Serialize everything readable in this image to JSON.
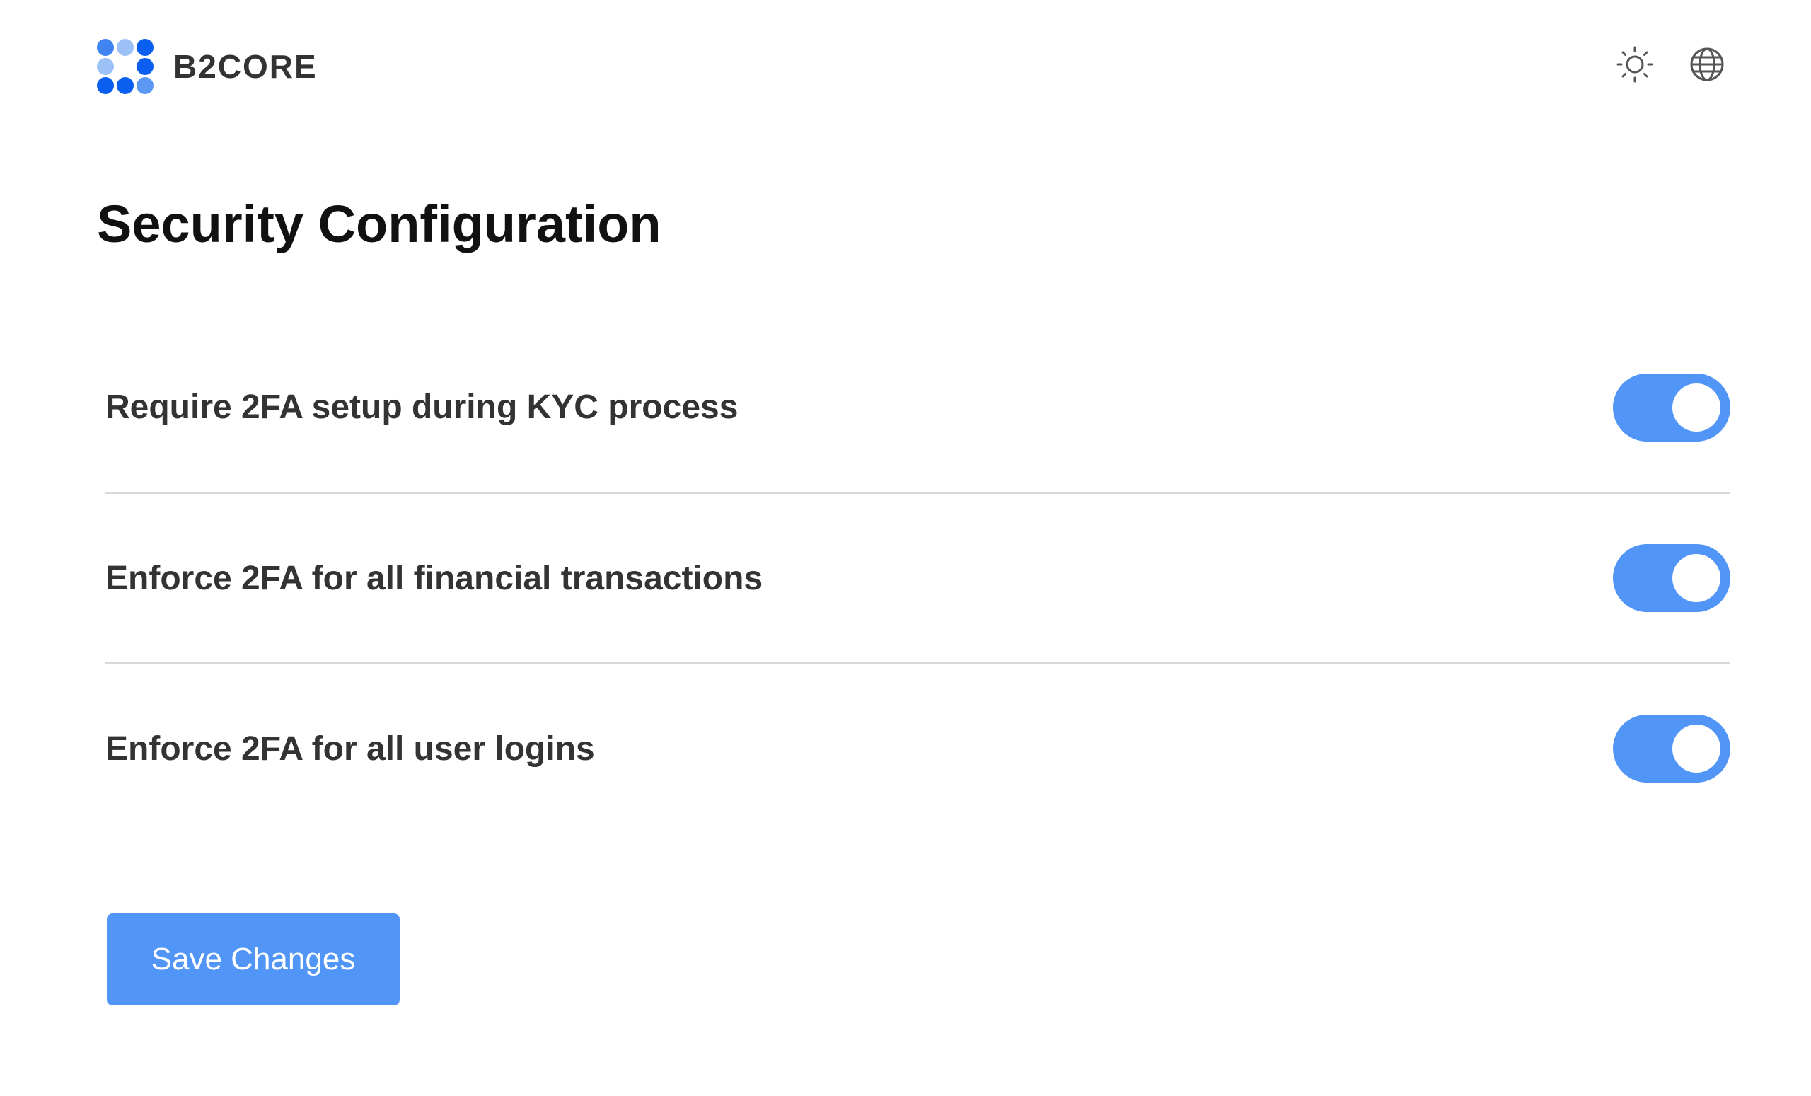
{
  "brand": {
    "name": "B2CORE",
    "colors": {
      "primary": "#0a5ef0",
      "light": "#7fb0f5",
      "mid": "#4c8df2"
    }
  },
  "header": {
    "theme_icon": "sun-icon",
    "language_icon": "globe-icon"
  },
  "page": {
    "title": "Security Configuration"
  },
  "settings": [
    {
      "label": "Require 2FA setup during KYC process",
      "enabled": true
    },
    {
      "label": "Enforce 2FA for all financial transactions",
      "enabled": true
    },
    {
      "label": "Enforce 2FA for all user logins",
      "enabled": true
    }
  ],
  "actions": {
    "save_label": "Save Changes"
  },
  "colors": {
    "accent": "#5196f7",
    "divider": "#d9d9d9",
    "text": "#333333"
  }
}
